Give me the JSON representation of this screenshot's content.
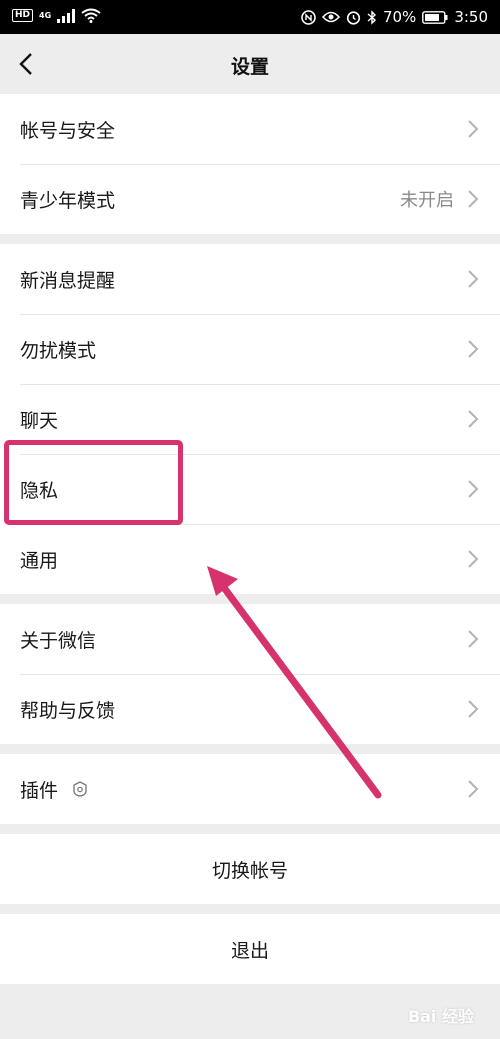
{
  "status_bar": {
    "hd": "HD",
    "network": "4G",
    "battery": "70%",
    "time": "3:50",
    "icons": [
      "hd-badge",
      "signal-icon",
      "wifi-icon",
      "nfc-icon",
      "eye-icon",
      "alarm-icon",
      "bluetooth-icon",
      "battery-icon"
    ]
  },
  "navbar": {
    "back_icon": "chevron-left-icon",
    "title": "设置"
  },
  "groups": [
    {
      "items": [
        {
          "label": "帐号与安全"
        },
        {
          "label": "青少年模式",
          "value": "未开启"
        }
      ]
    },
    {
      "items": [
        {
          "label": "新消息提醒"
        },
        {
          "label": "勿扰模式"
        },
        {
          "label": "聊天"
        },
        {
          "label": "隐私"
        },
        {
          "label": "通用"
        }
      ]
    },
    {
      "items": [
        {
          "label": "关于微信"
        },
        {
          "label": "帮助与反馈"
        }
      ]
    },
    {
      "items": [
        {
          "label": "插件",
          "icon": "plugin-icon"
        }
      ]
    }
  ],
  "actions": {
    "switch_account": "切换帐号",
    "logout": "退出"
  },
  "annotation": {
    "highlight_color": "#d6326e"
  },
  "watermark": "Bai 经验"
}
